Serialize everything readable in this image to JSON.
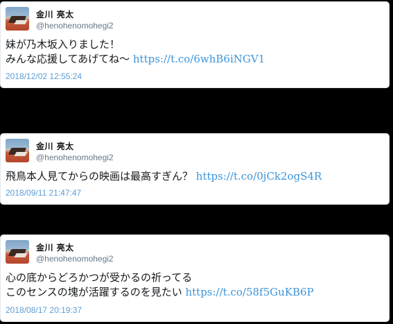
{
  "tweets": [
    {
      "user": {
        "name": "金川 亮太",
        "handle": "@henohenomohegi2"
      },
      "lines": [
        "妹が乃木坂入りました！",
        "みんな応援してあげてね〜"
      ],
      "link": "https://t.co/6whB6iNGV1",
      "timestamp": "2018/12/02 12:55:24"
    },
    {
      "user": {
        "name": "金川 亮太",
        "handle": "@henohenomohegi2"
      },
      "lines": [
        "飛鳥本人見てからの映画は最高すぎん？"
      ],
      "link": "https://t.co/0jCk2ogS4R",
      "timestamp": "2018/09/11 21:47:47"
    },
    {
      "user": {
        "name": "金川 亮太",
        "handle": "@henohenomohegi2"
      },
      "lines": [
        "心の底からどろかつが受かるの祈ってる",
        "このセンスの塊が活躍するのを見たい"
      ],
      "link": "https://t.co/58f5GuKB6P",
      "timestamp": "2018/08/17 20:19:37"
    }
  ],
  "colors": {
    "background": "#000000",
    "card": "#ffffff",
    "link": "#3b94d9",
    "timestamp": "#5b9bd5",
    "handle": "#657786",
    "text": "#14171a"
  }
}
